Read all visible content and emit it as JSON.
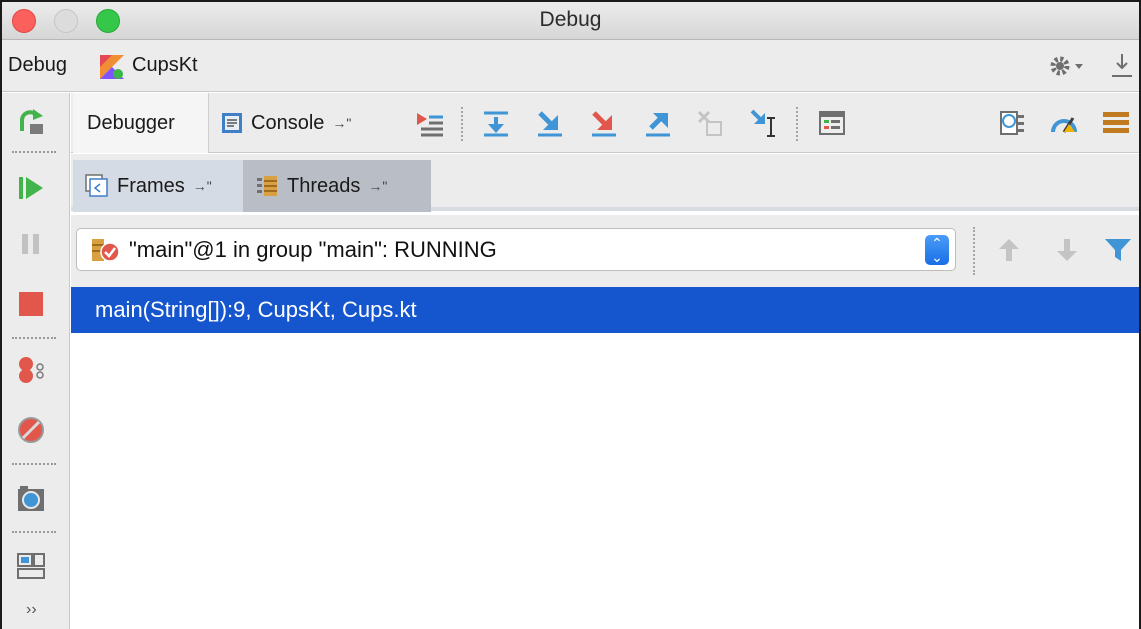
{
  "window": {
    "title": "Debug"
  },
  "header": {
    "debug_label": "Debug",
    "config_name": "CupsKt"
  },
  "tabs": {
    "debugger": "Debugger",
    "console": "Console",
    "pin_glyph": "→\""
  },
  "subtabs": {
    "frames": "Frames",
    "threads": "Threads",
    "pin_glyph": "→\""
  },
  "thread_select": {
    "value": "\"main\"@1 in group \"main\": RUNNING",
    "arrow_glyph": "⌃⌄"
  },
  "frames": [
    {
      "text": "main(String[]):9, CupsKt, Cups.kt",
      "selected": true
    }
  ],
  "left_toolbar": {
    "more_glyph": "››"
  },
  "icons": [
    "kotlin-icon",
    "gear-icon",
    "hide-icon",
    "rerun-icon",
    "resume-icon",
    "pause-icon",
    "stop-icon",
    "view-breakpoints-icon",
    "mute-breakpoints-icon",
    "camera-icon",
    "layout-icon",
    "console-icon",
    "show-execution-point-icon",
    "step-over-icon",
    "step-into-icon",
    "force-step-into-icon",
    "step-out-icon",
    "drop-frame-icon",
    "run-to-cursor-icon",
    "evaluate-icon",
    "memory-icon",
    "overhead-icon",
    "settings-icon",
    "frames-icon",
    "threads-icon",
    "thread-status-icon",
    "up-arrow-icon",
    "down-arrow-icon",
    "filter-icon"
  ],
  "colors": {
    "selection": "#1556cf",
    "stop_red": "#e2574c",
    "resume_green": "#43b34b",
    "accent_blue": "#2f8fd5"
  }
}
